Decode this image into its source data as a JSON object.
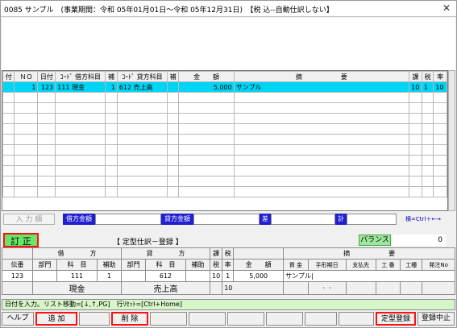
{
  "window": {
    "title": "0085 サンプル　(事業期間：令和 05年01月01日～令和 05年12月31日)　【税 込--自動仕訳しない】"
  },
  "grid": {
    "headers": [
      "付",
      "ＮＯ",
      "日付",
      "ｺｰﾄﾞ 借方科目",
      "補",
      "ｺｰﾄﾞ 貸方科目",
      "補",
      "金　　額",
      "摘　　　　　　要",
      "課",
      "税",
      "率"
    ],
    "rows": [
      {
        "flag": "",
        "no": "1",
        "date": "123",
        "debit": "111 現金",
        "debit_sub": "1",
        "credit": "612 売上高",
        "credit_sub": "",
        "amount": "5,000",
        "memo": "サンプル",
        "ka": "10",
        "tax": "1",
        "rate": "10"
      }
    ]
  },
  "totals": {
    "order_button": "入 力 順",
    "debit_total_label": "借方金額",
    "credit_total_label": "貸方金額",
    "diff_label": "差",
    "sum_label": "計",
    "hint": "横=Ctrl＋←→"
  },
  "entry": {
    "mode": "訂 正",
    "title": "【 定型仕訳－登録 】",
    "balance_label": "バランス",
    "balance_value": "0",
    "head1": {
      "debit": "借　　　　方",
      "credit": "貸　　　　方",
      "ka": "課",
      "tax": "税",
      "memo": "摘　　　　　　要"
    },
    "head2": {
      "slip": "伝番",
      "dept": "部門",
      "account": "科　目",
      "sub": "補助",
      "cdept": "部門",
      "caccount": "科　目",
      "csub": "補助",
      "ka": "税",
      "rate": "率",
      "amount": "金　　額",
      "m1": "資 金",
      "m2": "手形期日",
      "m3": "支払先",
      "m4": "工 番",
      "m5": "工種",
      "m6": "発注No"
    },
    "values": {
      "slip": "123",
      "dept": "",
      "account": "111",
      "sub": "1",
      "cdept": "",
      "caccount": "612",
      "csub": "",
      "ka": "10",
      "rate": "1",
      "amount": "5,000",
      "memo": "サンプル|"
    },
    "names": {
      "debit_name": "現金",
      "credit_name": "売上高",
      "ka2": "10",
      "dots": "・・"
    }
  },
  "status": "日付を入力。リスト移動=[↓,↑,PG]　行ﾘｾｯﾄ=[Ctrl+Home]",
  "fkeys": {
    "f1": "ヘルプ",
    "f2": "追 加",
    "f3": "削 除",
    "f4": "",
    "f5": "",
    "f6": "",
    "f7": "",
    "f8": "",
    "f9": "",
    "f11": "定型登録",
    "f12": "登録中止"
  }
}
